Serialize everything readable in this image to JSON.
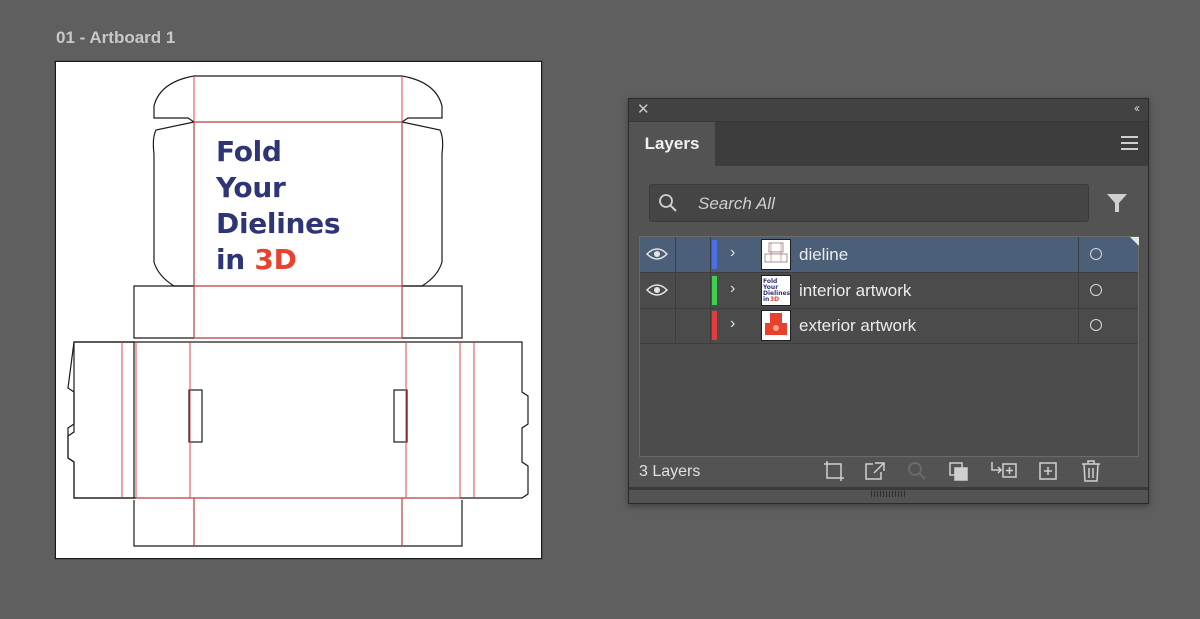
{
  "artboard": {
    "label": "01 - Artboard 1",
    "headline": {
      "lines": [
        "Fold",
        "Your",
        "Dielines"
      ],
      "last_line_prefix": "in",
      "last_line_accent": "3D"
    }
  },
  "layers_panel": {
    "tab_label": "Layers",
    "search_placeholder": "Search All",
    "layers": [
      {
        "name": "dieline",
        "visible": true,
        "selected": true,
        "color": "#4a70e6",
        "thumb_text": ""
      },
      {
        "name": "interior artwork",
        "visible": true,
        "selected": false,
        "color": "#3fce4d",
        "thumb_text": "Fold Your Dielines in 3D"
      },
      {
        "name": "exterior artwork",
        "visible": false,
        "selected": false,
        "color": "#e23c3c",
        "thumb_text": ""
      }
    ],
    "status": "3 Layers",
    "footer_icons": [
      "artboard-collect-icon",
      "export-icon",
      "locate-object-icon",
      "clipping-mask-icon",
      "new-sublayer-icon",
      "new-layer-icon",
      "delete-icon"
    ]
  },
  "colors": {
    "canvas_bg": "#5f5f5f",
    "headline_blue": "#2e3575",
    "headline_red": "#e8422e",
    "fold_line": "#e04545",
    "selection": "#4b5f78"
  }
}
